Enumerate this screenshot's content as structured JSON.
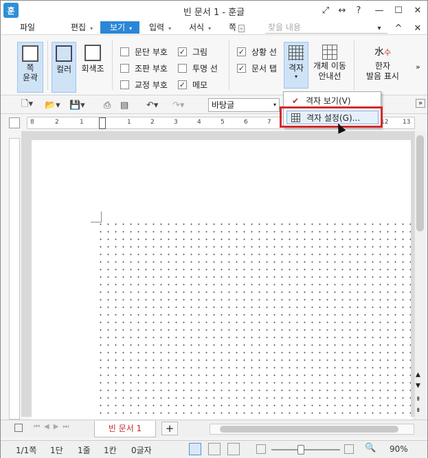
{
  "window": {
    "app_icon": "훈",
    "title": "빈 문서 1 - 훈글",
    "controls": [
      "⤢",
      "↔",
      "?",
      "—",
      "☐",
      "✕"
    ]
  },
  "menu": {
    "items": [
      {
        "label": "파일",
        "arrow": ""
      },
      {
        "label": "편집",
        "arrow": "▾"
      },
      {
        "label": "보기",
        "arrow": "▾",
        "active": true
      },
      {
        "label": "입력",
        "arrow": "▾"
      },
      {
        "label": "서식",
        "arrow": "▾"
      },
      {
        "label": "쪽",
        "arrow": "»"
      }
    ],
    "search_placeholder": "찾을 내용",
    "right_icons": [
      "▾",
      "^",
      "✕"
    ]
  },
  "ribbon": {
    "page_outline": "쪽\n윤곽",
    "color": "컬러",
    "grayscale": "회색조",
    "checkboxes": [
      {
        "label": "문단 부호",
        "checked": false
      },
      {
        "label": "조판 부호",
        "checked": false
      },
      {
        "label": "교정 부호",
        "checked": false
      },
      {
        "label": "그림",
        "checked": true
      },
      {
        "label": "투명 선",
        "checked": false
      },
      {
        "label": "메모",
        "checked": true
      },
      {
        "label": "상황 선",
        "checked": true
      },
      {
        "label": "문서 탭",
        "checked": true
      }
    ],
    "grid": "격자",
    "object_guide": "개체 이동\n안내선",
    "hanja": "한자\n발음 표시",
    "more": "»"
  },
  "toolbar": {
    "style_value": "바탕글"
  },
  "ruler": {
    "marks": [
      "8",
      "2",
      "1",
      "1",
      "2",
      "3",
      "4",
      "5",
      "6",
      "7",
      "8",
      "9",
      "10",
      "11",
      "12",
      "13"
    ]
  },
  "dropdown": {
    "items": [
      {
        "label": "격자 보기(V)",
        "checked": true
      },
      {
        "label": "격자 설정(G)...",
        "checked": false,
        "hover": true
      }
    ]
  },
  "tabs": {
    "doc_tab": "빈 문서 1",
    "add": "+"
  },
  "status": {
    "page": "1/1쪽",
    "section": "1단",
    "line": "1줄",
    "column": "1칸",
    "chars": "0글자",
    "zoom": "90%"
  }
}
